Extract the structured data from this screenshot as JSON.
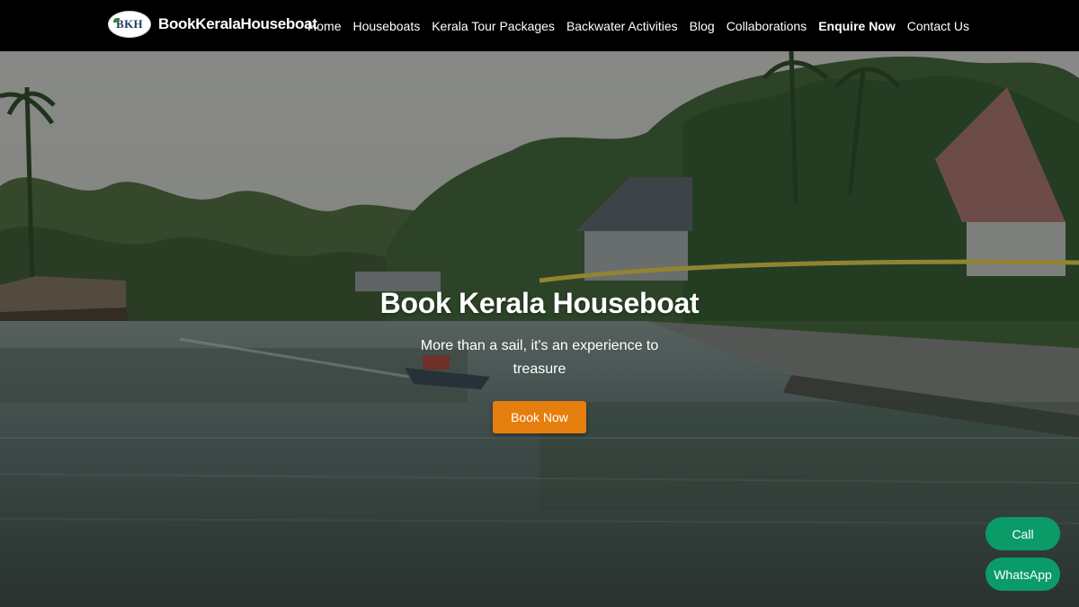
{
  "header": {
    "logo_text": "BKH",
    "brand_name": "BookKeralaHouseboat",
    "nav": [
      {
        "label": "Home"
      },
      {
        "label": "Houseboats"
      },
      {
        "label": "Kerala Tour Packages"
      },
      {
        "label": "Backwater Activities"
      },
      {
        "label": "Blog"
      },
      {
        "label": "Collaborations"
      },
      {
        "label": "Enquire Now",
        "bold": true
      },
      {
        "label": "Contact Us"
      }
    ]
  },
  "hero": {
    "title": "Book Kerala Houseboat",
    "subtitle": "More than a sail, it's an experience to treasure",
    "cta_label": "Book Now"
  },
  "floating": {
    "call_label": "Call",
    "whatsapp_label": "WhatsApp"
  },
  "colors": {
    "navbar_bg": "#000000",
    "cta_orange": "#e67e0e",
    "float_green": "#0b9b68"
  }
}
